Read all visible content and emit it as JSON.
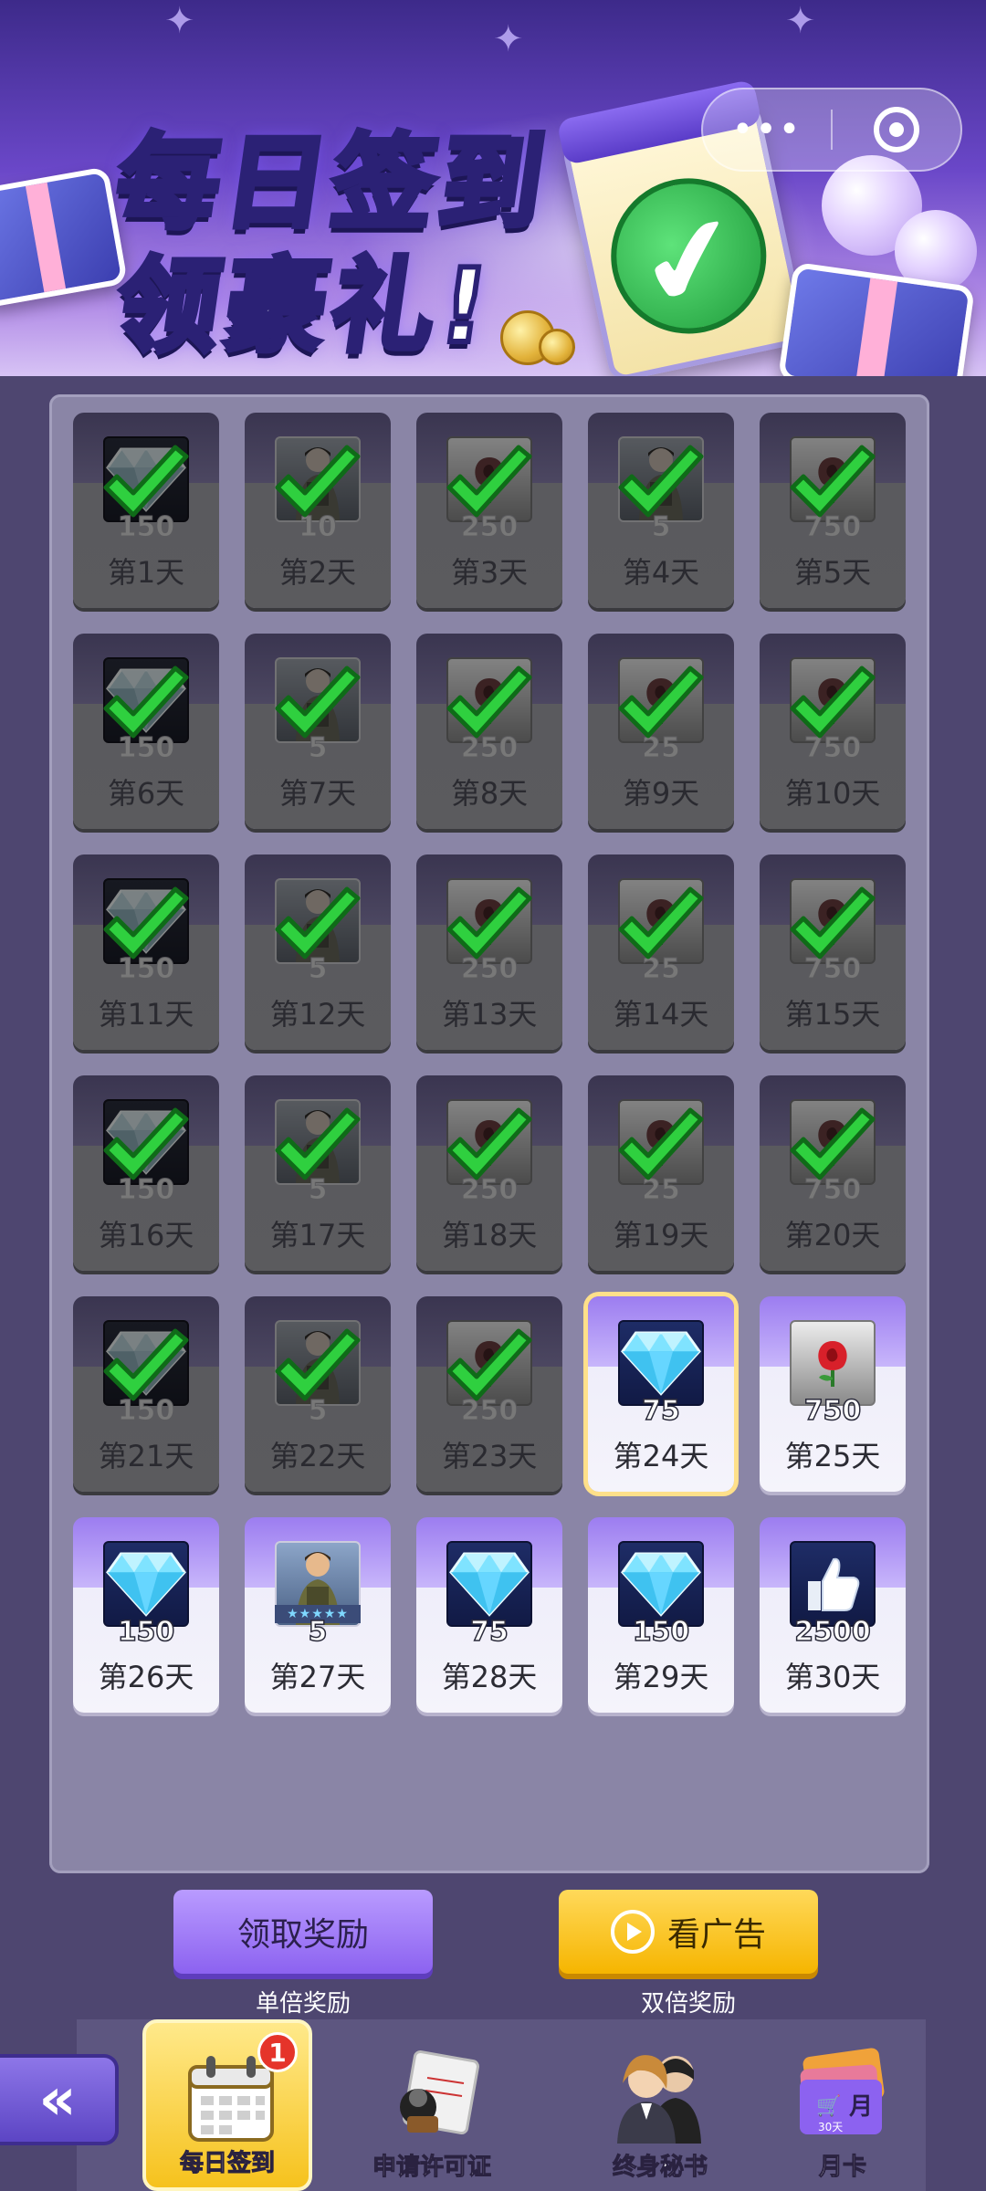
{
  "banner": {
    "title_line1": "每日签到",
    "title_line2": "领豪礼!",
    "capsule_more": "•••"
  },
  "days": [
    {
      "day": "第1天",
      "qty": "150",
      "reward": "diamond",
      "claimed": true
    },
    {
      "day": "第2天",
      "qty": "10",
      "reward": "soldier",
      "claimed": true
    },
    {
      "day": "第3天",
      "qty": "250",
      "reward": "rose",
      "claimed": true
    },
    {
      "day": "第4天",
      "qty": "5",
      "reward": "soldier",
      "claimed": true
    },
    {
      "day": "第5天",
      "qty": "750",
      "reward": "rose",
      "claimed": true
    },
    {
      "day": "第6天",
      "qty": "150",
      "reward": "diamond",
      "claimed": true
    },
    {
      "day": "第7天",
      "qty": "5",
      "reward": "soldier",
      "claimed": true
    },
    {
      "day": "第8天",
      "qty": "250",
      "reward": "rose",
      "claimed": true
    },
    {
      "day": "第9天",
      "qty": "25",
      "reward": "rose",
      "claimed": true
    },
    {
      "day": "第10天",
      "qty": "750",
      "reward": "rose",
      "claimed": true
    },
    {
      "day": "第11天",
      "qty": "150",
      "reward": "diamond",
      "claimed": true
    },
    {
      "day": "第12天",
      "qty": "5",
      "reward": "soldier",
      "claimed": true
    },
    {
      "day": "第13天",
      "qty": "250",
      "reward": "rose",
      "claimed": true
    },
    {
      "day": "第14天",
      "qty": "25",
      "reward": "rose",
      "claimed": true
    },
    {
      "day": "第15天",
      "qty": "750",
      "reward": "rose",
      "claimed": true
    },
    {
      "day": "第16天",
      "qty": "150",
      "reward": "diamond",
      "claimed": true
    },
    {
      "day": "第17天",
      "qty": "5",
      "reward": "soldier",
      "claimed": true
    },
    {
      "day": "第18天",
      "qty": "250",
      "reward": "rose",
      "claimed": true
    },
    {
      "day": "第19天",
      "qty": "25",
      "reward": "rose",
      "claimed": true
    },
    {
      "day": "第20天",
      "qty": "750",
      "reward": "rose",
      "claimed": true
    },
    {
      "day": "第21天",
      "qty": "150",
      "reward": "diamond",
      "claimed": true
    },
    {
      "day": "第22天",
      "qty": "5",
      "reward": "soldier",
      "claimed": true
    },
    {
      "day": "第23天",
      "qty": "250",
      "reward": "rose",
      "claimed": true
    },
    {
      "day": "第24天",
      "qty": "75",
      "reward": "diamond",
      "claimed": false,
      "today": true
    },
    {
      "day": "第25天",
      "qty": "750",
      "reward": "rose",
      "claimed": false
    },
    {
      "day": "第26天",
      "qty": "150",
      "reward": "diamond",
      "claimed": false
    },
    {
      "day": "第27天",
      "qty": "5",
      "reward": "soldier",
      "claimed": false
    },
    {
      "day": "第28天",
      "qty": "75",
      "reward": "diamond",
      "claimed": false
    },
    {
      "day": "第29天",
      "qty": "150",
      "reward": "diamond",
      "claimed": false
    },
    {
      "day": "第30天",
      "qty": "2500",
      "reward": "like",
      "claimed": false
    }
  ],
  "actions": {
    "claim_label": "领取奖励",
    "claim_sub": "单倍奖励",
    "ad_label": "看广告",
    "ad_sub": "双倍奖励"
  },
  "nav": {
    "back_glyph": "«",
    "tabs": [
      {
        "label": "每日签到",
        "active": true,
        "badge": "1",
        "icon": "calendar-icon"
      },
      {
        "label": "申请许可证",
        "active": false,
        "icon": "stamp-icon"
      },
      {
        "label": "终身秘书",
        "active": false,
        "icon": "secretary-icon"
      },
      {
        "label": "月卡",
        "active": false,
        "icon": "card-icon",
        "card_text": "月",
        "card_small": "30天"
      }
    ]
  },
  "colors": {
    "accent_purple": "#8c62f0",
    "accent_yellow": "#f6b500",
    "check_green": "#2fbf3f",
    "badge_red": "#e5342a"
  }
}
